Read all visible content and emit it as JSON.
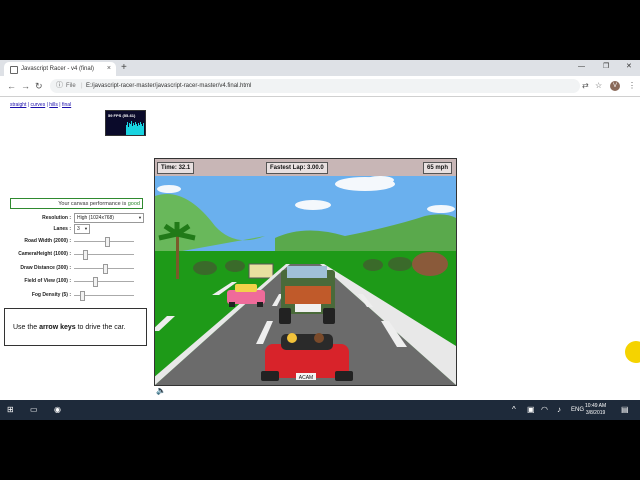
{
  "browser": {
    "tab_title": "Javascript Racer - v4 (final)",
    "tab_close": "×",
    "new_tab": "+",
    "url_scheme_label": "File",
    "url": "E:/javascript-racer-master/javascript-racer-master/v4.final.html",
    "avatar_letter": "V"
  },
  "page": {
    "links": [
      "straight",
      "curves",
      "hills",
      "final"
    ],
    "fps_label": "59 FPS (55-61)",
    "perf_text": "Your canvas performance is ",
    "perf_status": "good",
    "controls": [
      {
        "label": "Resolution :",
        "kind": "select",
        "value": "High (1024x768)"
      },
      {
        "label": "Lanes :",
        "kind": "select",
        "value": "3"
      },
      {
        "label": "Road Width (2000) :",
        "kind": "slider",
        "level": 0.55
      },
      {
        "label": "CameraHeight (1000) :",
        "kind": "slider",
        "level": 0.15
      },
      {
        "label": "Draw Distance (300) :",
        "kind": "slider",
        "level": 0.5
      },
      {
        "label": "Field of View (100) :",
        "kind": "slider",
        "level": 0.33
      },
      {
        "label": "Fog Density (5) :",
        "kind": "slider",
        "level": 0.1
      }
    ],
    "instructions_pre": "Use the ",
    "instructions_keys": "arrow keys",
    "instructions_post": " to drive the car."
  },
  "hud": {
    "time_label": "Time:",
    "time_value": "32.1",
    "fastest_label": "Fastest Lap:",
    "fastest_value": "3.00.0",
    "speed": "65 mph",
    "plate": "ACAM"
  },
  "taskbar": {
    "time": "10:49 AM",
    "date": "3/8/2019",
    "lang": "ENG"
  },
  "colors": {
    "sky": "#6ab0ee",
    "grass": "#1e9a18",
    "road": "#6b6b6b",
    "taskbar": "#1e2a3a"
  }
}
